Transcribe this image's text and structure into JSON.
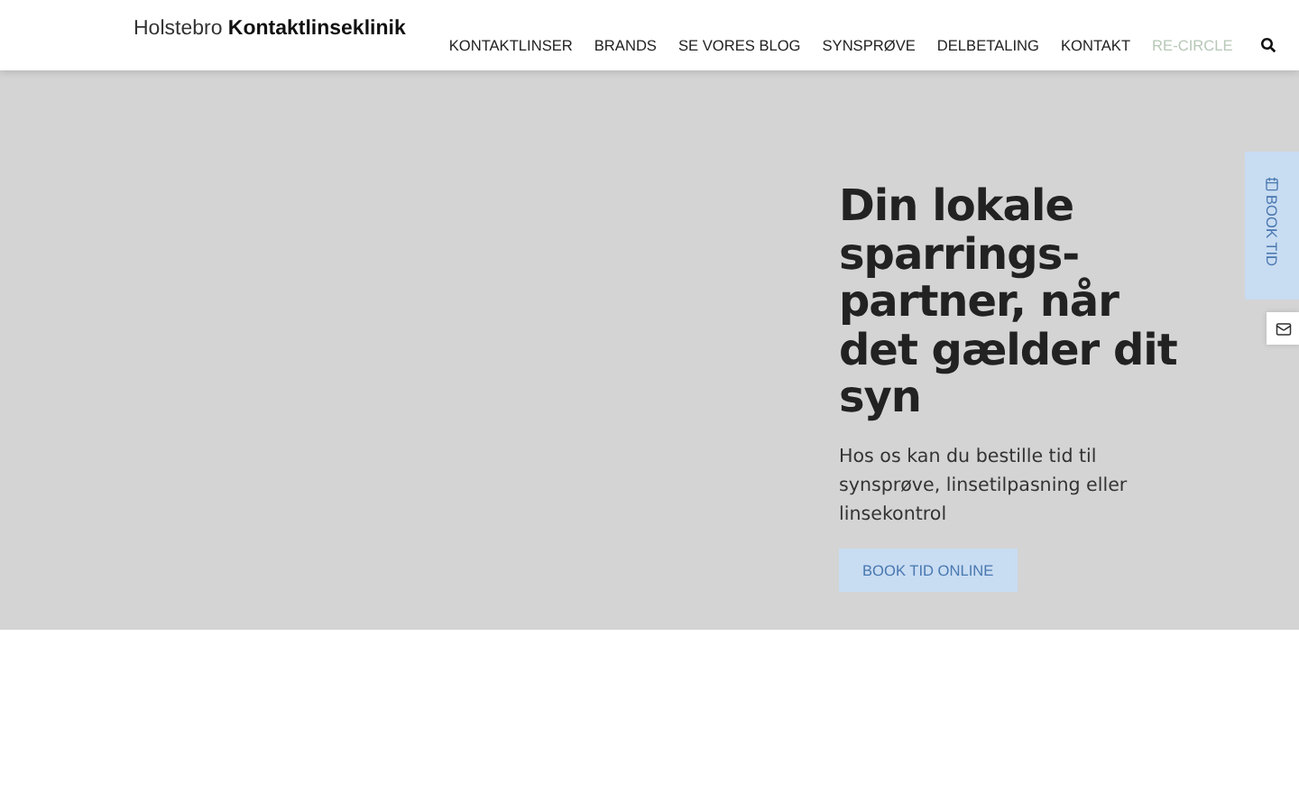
{
  "header": {
    "logo": "Holstebro **Kontaktlinseklinik**",
    "nav": [
      {
        "label": "KONTAKTLINSER",
        "selected": false
      },
      {
        "label": "BRANDS",
        "selected": false
      },
      {
        "label": "SE VORES BLOG",
        "selected": false
      },
      {
        "label": "SYNSPRØVE",
        "selected": false
      },
      {
        "label": "DELBETALING",
        "selected": false
      },
      {
        "label": "KONTAKT",
        "selected": false
      },
      {
        "label": "RE-CIRCLE",
        "selected": true
      }
    ]
  },
  "hero": {
    "heading": "Din lokale sparrings-partner, når det gælder dit syn",
    "text": "Hos os kan du bestille tid til synsprøve, linsetilpasning eller linsekontrol",
    "button": "BOOK TID ONLINE"
  },
  "side_tab": {
    "label": "BOOK TID"
  }
}
